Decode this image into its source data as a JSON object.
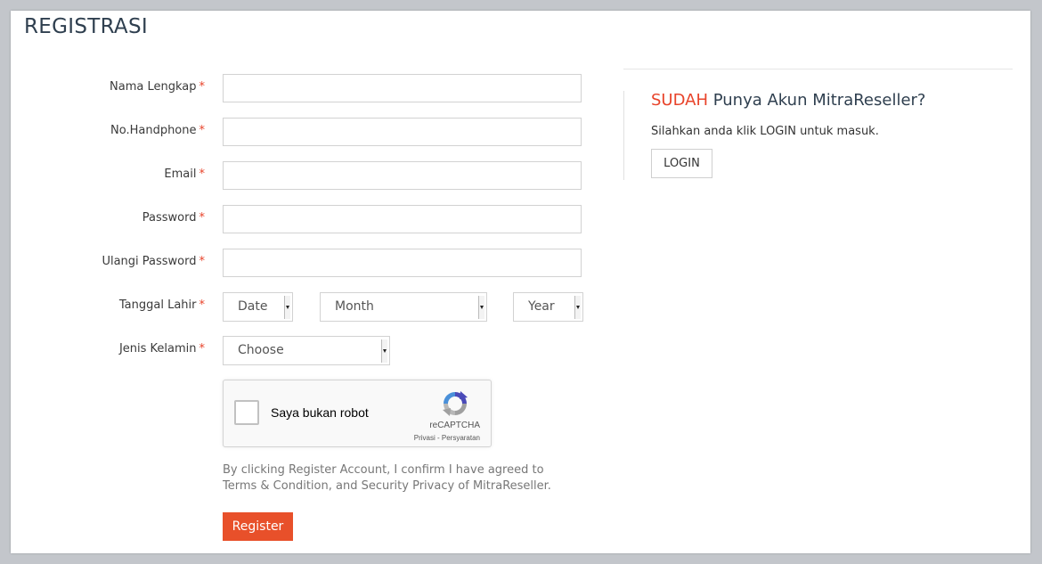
{
  "page": {
    "title": "REGISTRASI"
  },
  "form": {
    "required_mark": "*",
    "fields": {
      "nama": {
        "label": "Nama Lengkap",
        "value": ""
      },
      "phone": {
        "label": "No.Handphone",
        "value": ""
      },
      "email": {
        "label": "Email",
        "value": ""
      },
      "password": {
        "label": "Password",
        "value": ""
      },
      "password2": {
        "label": "Ulangi Password",
        "value": ""
      }
    },
    "tanggal_lahir": {
      "label": "Tanggal Lahir",
      "date": "Date",
      "month": "Month",
      "year": "Year"
    },
    "jenis_kelamin": {
      "label": "Jenis Kelamin",
      "value": "Choose"
    },
    "captcha": {
      "label": "Saya bukan robot",
      "brand": "reCAPTCHA",
      "links": "Privasi - Persyaratan"
    },
    "terms": "By clicking Register Account, I confirm I have agreed to Terms & Condition, and Security Privacy of MitraReseller.",
    "register_label": "Register"
  },
  "login_panel": {
    "heading_accent": "SUDAH",
    "heading_rest": " Punya Akun MitraReseller?",
    "text": "Silahkan anda klik LOGIN untuk masuk.",
    "button_label": "LOGIN"
  },
  "colors": {
    "accent": "#e8502a",
    "required": "#e8432a",
    "background": "#c3c6cb"
  }
}
